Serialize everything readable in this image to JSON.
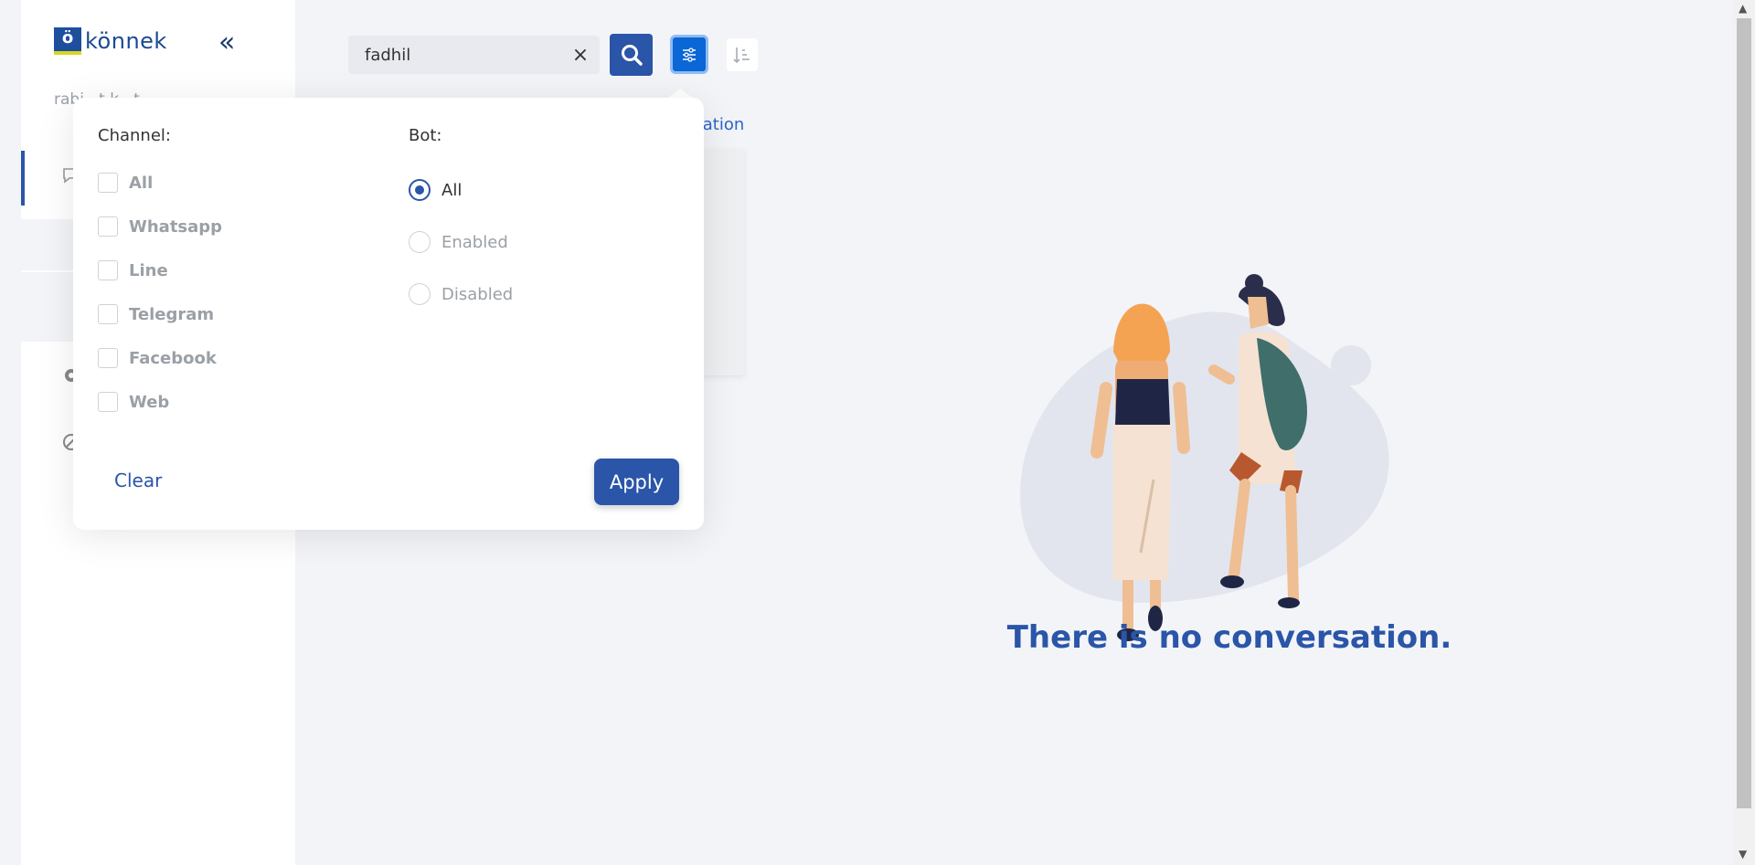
{
  "app": {
    "logo_letter": "ö",
    "logo_text": "könnek",
    "collapse_icon": "double-chevron-left-icon",
    "user_name": "rabi...t.k...t"
  },
  "toolbar": {
    "search_value": "fadhil",
    "clear_glyph": "×",
    "search_icon": "search-icon",
    "filter_icon": "sliders-icon",
    "sort_icon": "sort-icon"
  },
  "list_header": {
    "link_fragment": "rsation"
  },
  "filter_popover": {
    "channel_title": "Channel:",
    "bot_title": "Bot:",
    "channels": [
      {
        "label": "All",
        "checked": false
      },
      {
        "label": "Whatsapp",
        "checked": false
      },
      {
        "label": "Line",
        "checked": false
      },
      {
        "label": "Telegram",
        "checked": false
      },
      {
        "label": "Facebook",
        "checked": false
      },
      {
        "label": "Web",
        "checked": false
      }
    ],
    "bot_options": [
      {
        "label": "All",
        "selected": true
      },
      {
        "label": "Enabled",
        "selected": false
      },
      {
        "label": "Disabled",
        "selected": false
      }
    ],
    "clear_label": "Clear",
    "apply_label": "Apply"
  },
  "empty_state": {
    "message": "There is no conversation."
  },
  "colors": {
    "primary": "#2a55a8",
    "filter_active": "#0b66d6",
    "background": "#f3f4f8"
  }
}
